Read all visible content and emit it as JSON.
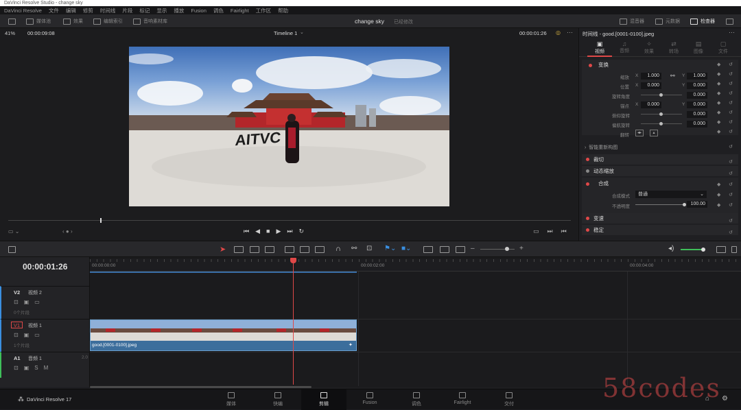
{
  "window": {
    "title": "DaVinci Resolve Studio - change sky"
  },
  "menu": [
    "DaVinci Resolve",
    "文件",
    "编辑",
    "修剪",
    "时间线",
    "片段",
    "标记",
    "显示",
    "播放",
    "Fusion",
    "调色",
    "Fairlight",
    "工作区",
    "帮助"
  ],
  "toolbar": {
    "left_buttons": [
      "媒体池",
      "效果",
      "编辑索引",
      "音响素材库"
    ],
    "project_name": "change sky",
    "project_status": "已经修改",
    "right_buttons": [
      "混音器",
      "元数据",
      "检查器"
    ]
  },
  "viewer": {
    "zoom": "41%",
    "source_timecode": "00:00:09:08",
    "timeline_name": "Timeline 1",
    "record_timecode": "00:00:01:26",
    "overlay_text": "AITVC"
  },
  "inspector": {
    "title": "时间线 - good.[0001-0100].jpeg",
    "tabs": [
      "视频",
      "音频",
      "效果",
      "转场",
      "图像",
      "文件"
    ],
    "transform": {
      "label": "变换",
      "rows": [
        {
          "name": "缩放",
          "x": "1.000",
          "y": "1.000"
        },
        {
          "name": "位置",
          "x": "0.000",
          "y": "0.000"
        },
        {
          "name": "旋转角度",
          "val": "0.000"
        },
        {
          "name": "锚点",
          "x": "0.000",
          "y": "0.000"
        },
        {
          "name": "俯仰旋转",
          "val": "0.000"
        },
        {
          "name": "偏航旋转",
          "val": "0.000"
        },
        {
          "name": "翻转",
          "val": ""
        }
      ],
      "x_label": "X",
      "y_label": "Y"
    },
    "smart_reframe": "智能重新构图",
    "sections": [
      "裁切",
      "动态缩放",
      "合成",
      "变速",
      "稳定"
    ],
    "composite": {
      "mode_label": "合成模式",
      "mode_value": "普通",
      "opacity_label": "不透明度",
      "opacity_value": "100.00"
    }
  },
  "timeline": {
    "timecode": "00:00:01:26",
    "ruler": [
      "00:00:00:00",
      "00:00:02:00",
      "00:00:04:00"
    ],
    "tracks": [
      {
        "id": "V2",
        "name": "视频 2",
        "info": "0个片段"
      },
      {
        "id": "V1",
        "name": "视频 1",
        "info": "1个片段"
      },
      {
        "id": "A1",
        "name": "音频 1",
        "info": "2.0"
      }
    ],
    "clip_name": "good.[0001-0100].jpeg"
  },
  "footer": {
    "app": "DaVinci Resolve 17",
    "pages": [
      "媒体",
      "快编",
      "剪辑",
      "Fusion",
      "调色",
      "Fairlight",
      "交付"
    ],
    "active_page": "剪辑"
  },
  "watermark": "58codes",
  "colors": {
    "accent": "#e04848",
    "clip": "#3c6e9c",
    "playhead": "#e04848",
    "active_page": "#ffffff"
  }
}
